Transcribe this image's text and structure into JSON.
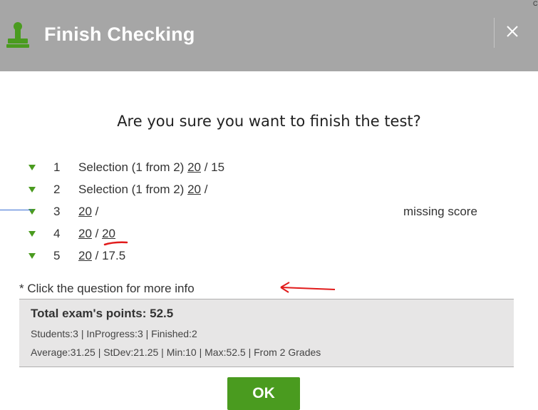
{
  "dialog": {
    "title": "Finish Checking",
    "corner_mark": "C",
    "question": "Are you sure you want to finish the test?",
    "items": [
      {
        "number": "1",
        "label": "Selection (1 from 2)",
        "score": "20",
        "separator": " / ",
        "value": "15"
      },
      {
        "number": "2",
        "label": "Selection (1 from 2)",
        "score": "20",
        "separator": " /",
        "value": ""
      },
      {
        "number": "3",
        "label": "",
        "score": "20",
        "separator": " /",
        "value": ""
      },
      {
        "number": "4",
        "label": "",
        "score": "20",
        "separator": " / ",
        "value": "20"
      },
      {
        "number": "5",
        "label": "",
        "score": "20",
        "separator": " / ",
        "value": "17.5"
      }
    ],
    "missing_note": "missing score",
    "hint": "* Click the question for more info",
    "summary": {
      "total": "Total exam's points: 52.5",
      "line1": "Students:3 | InProgress:3 | Finished:2",
      "line2": "Average:31.25 | StDev:21.25 | Min:10 | Max:52.5 | From 2 Grades"
    },
    "ok_label": "OK"
  },
  "colors": {
    "header_bg": "#a6a6a6",
    "accent_green": "#4a9b1f",
    "annotation_red": "#e11b1b",
    "annotation_blue": "#3a6fd4"
  }
}
